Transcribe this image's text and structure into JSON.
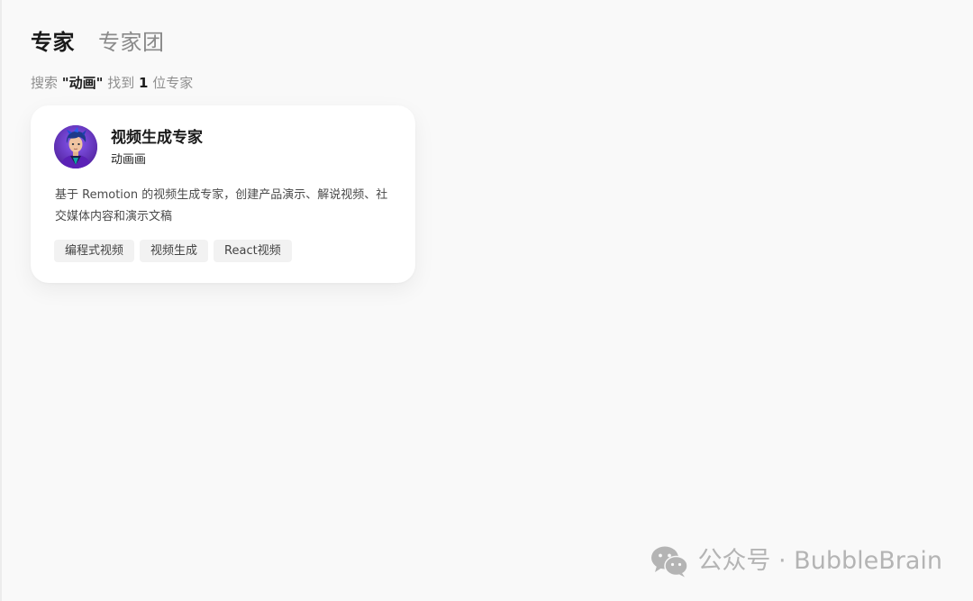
{
  "tabs": [
    {
      "label": "专家",
      "active": true
    },
    {
      "label": "专家团",
      "active": false
    }
  ],
  "summary": {
    "prefix": "搜索",
    "query": "\"动画\"",
    "middle": "找到",
    "count": "1",
    "suffix": "位专家"
  },
  "card": {
    "avatar_icon": "avatar-portrait",
    "title": "视频生成专家",
    "subtitle": "动画画",
    "description": "基于 Remotion 的视频生成专家，创建产品演示、解说视频、社交媒体内容和演示文稿",
    "tags": [
      "编程式视频",
      "视频生成",
      "React视频"
    ]
  },
  "watermark": {
    "icon": "wechat-icon",
    "text": "公众号 · BubbleBrain"
  },
  "colors": {
    "background": "#f9f9f9",
    "card": "#ffffff",
    "tag_bg": "#f2f2f2",
    "active_tab": "#1a1a1a",
    "inactive_tab": "#8a8a8a",
    "avatar_bg": "#6a3fd0"
  }
}
